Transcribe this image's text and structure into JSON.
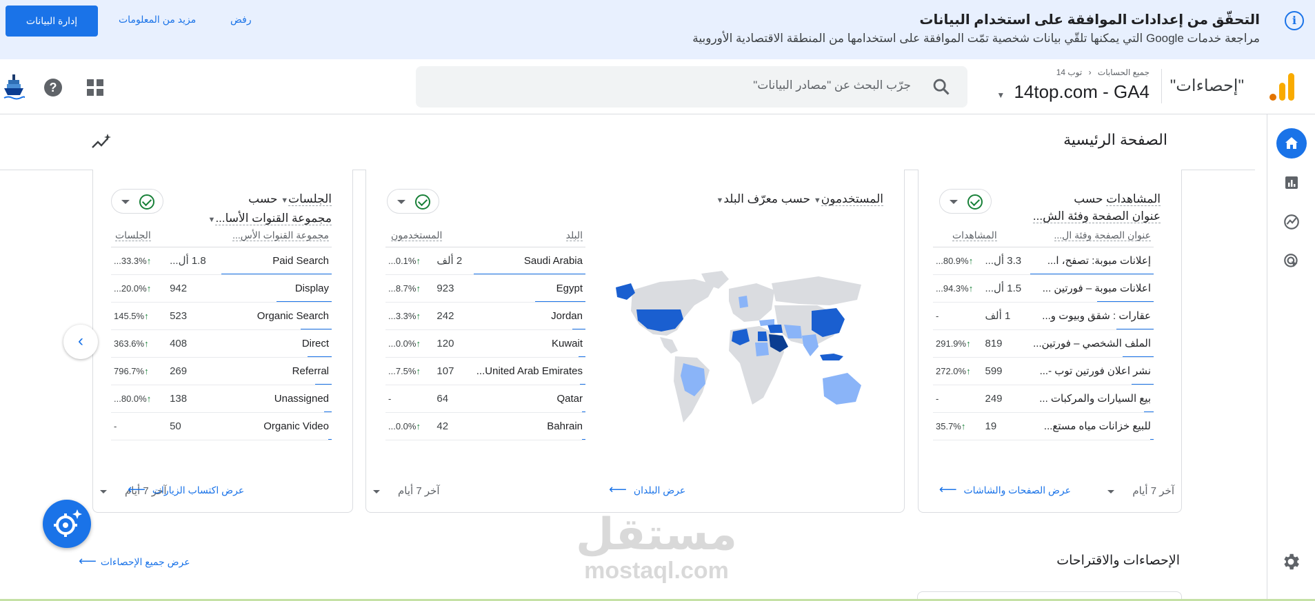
{
  "banner": {
    "title": "التحقّق من إعدادات الموافقة على استخدام البيانات",
    "subtitle": "مراجعة خدمات Google التي يمكنها تلقّي بيانات شخصية تمّت الموافقة على استخدامها من المنطقة الاقتصادية الأوروبية",
    "manage_label": "إدارة البيانات",
    "more_info_label": "مزيد من المعلومات",
    "reject_label": "رفض"
  },
  "header": {
    "app_name": "\"إحصاءات\"",
    "breadcrumb_all": "جميع الحسابات",
    "breadcrumb_sep": "‹",
    "breadcrumb_account": "توب 14",
    "property": "14top.com - GA4",
    "search_placeholder": "جرّب البحث عن \"مصادر البيانات\""
  },
  "page": {
    "title": "الصفحة الرئيسية",
    "insights_title": "الإحصاءات والاقتراحات",
    "view_all_insights": "عرض جميع الإحصاءات"
  },
  "watermark": {
    "ar": "مستقل",
    "en": "mostaql.com"
  },
  "cards": [
    {
      "title_metric": "المشاهدات",
      "title_rest": " حسب",
      "title_dim": "عنوان الصفحة وفئة الش...",
      "col_name": "عنوان الصفحة وفئة ال...",
      "col_value": "المشاهدات",
      "rows": [
        {
          "name": "إعلانات مبوبة: تصفح، ا...",
          "value": "3.3 أل...",
          "change": "80.9%...",
          "up": true,
          "share": 1.0
        },
        {
          "name": "اعلانات مبوبة – فورتين ...",
          "value": "1.5 أل...",
          "change": "94.3%...",
          "up": true,
          "share": 0.46
        },
        {
          "name": "عقارات : شقق وبيوت و...",
          "value": "1 ألف",
          "change": "-",
          "up": false,
          "share": 0.3
        },
        {
          "name": "الملف الشخصي – فورتين...",
          "value": "819",
          "change": "291.9%",
          "up": true,
          "share": 0.25
        },
        {
          "name": "نشر اعلان فورتين توب -...",
          "value": "599",
          "change": "272.0%",
          "up": true,
          "share": 0.18
        },
        {
          "name": "بيع السيارات والمركبات ...",
          "value": "249",
          "change": "-",
          "up": false,
          "share": 0.08
        },
        {
          "name": "للبيع خزانات مياه مستع...",
          "value": "19",
          "change": "35.7%",
          "up": true,
          "share": 0.01
        }
      ],
      "range": "آخر 7 أيام",
      "link": "عرض الصفحات والشاشات"
    },
    {
      "title_metric": "المستخدمون",
      "title_rest": " حسب معرّف البلد",
      "col_name": "البلد",
      "col_value": "المستخدمون",
      "rows": [
        {
          "name": "Saudi Arabia",
          "value": "2 ألف",
          "change": "0.1%...",
          "up": true,
          "share": 1.0
        },
        {
          "name": "Egypt",
          "value": "923",
          "change": "8.7%...",
          "up": true,
          "share": 0.45
        },
        {
          "name": "Jordan",
          "value": "242",
          "change": "3.3%...",
          "up": true,
          "share": 0.12
        },
        {
          "name": "Kuwait",
          "value": "120",
          "change": "0.0%...",
          "up": true,
          "share": 0.06
        },
        {
          "name": "United Arab Emirates...",
          "value": "107",
          "change": "7.5%...",
          "up": true,
          "share": 0.05
        },
        {
          "name": "Qatar",
          "value": "64",
          "change": "-",
          "up": false,
          "share": 0.03
        },
        {
          "name": "Bahrain",
          "value": "42",
          "change": "0.0%...",
          "up": true,
          "share": 0.02
        }
      ],
      "range": "آخر 7 أيام",
      "link": "عرض البلدان"
    },
    {
      "title_metric": "الجلسات",
      "title_rest": " حسب",
      "title_dim": "مجموعة القنوات الأسا...",
      "col_name": "مجموعة القنوات الأس...",
      "col_value": "الجلسات",
      "rows": [
        {
          "name": "Paid Search",
          "value": "1.8 أل...",
          "change": "33.3%...",
          "up": true,
          "share": 1.0
        },
        {
          "name": "Display",
          "value": "942",
          "change": "20.0%...",
          "up": true,
          "share": 0.5
        },
        {
          "name": "Organic Search",
          "value": "523",
          "change": "145.5%",
          "up": true,
          "share": 0.28
        },
        {
          "name": "Direct",
          "value": "408",
          "change": "363.6%",
          "up": true,
          "share": 0.22
        },
        {
          "name": "Referral",
          "value": "269",
          "change": "796.7%",
          "up": true,
          "share": 0.15
        },
        {
          "name": "Unassigned",
          "value": "138",
          "change": "80.0%...",
          "up": true,
          "share": 0.07
        },
        {
          "name": "Organic Video",
          "value": "50",
          "change": "-",
          "up": false,
          "share": 0.03
        }
      ],
      "range": "آخر 7 أيام",
      "link": "عرض اكتساب الزيارات"
    }
  ],
  "colors": {
    "accent": "#1a73e8",
    "map_dark": "#0b3d91",
    "map_mid": "#1a5fd0",
    "map_light": "#8ab4f8",
    "map_base": "#dadce0",
    "positive": "#188038"
  }
}
